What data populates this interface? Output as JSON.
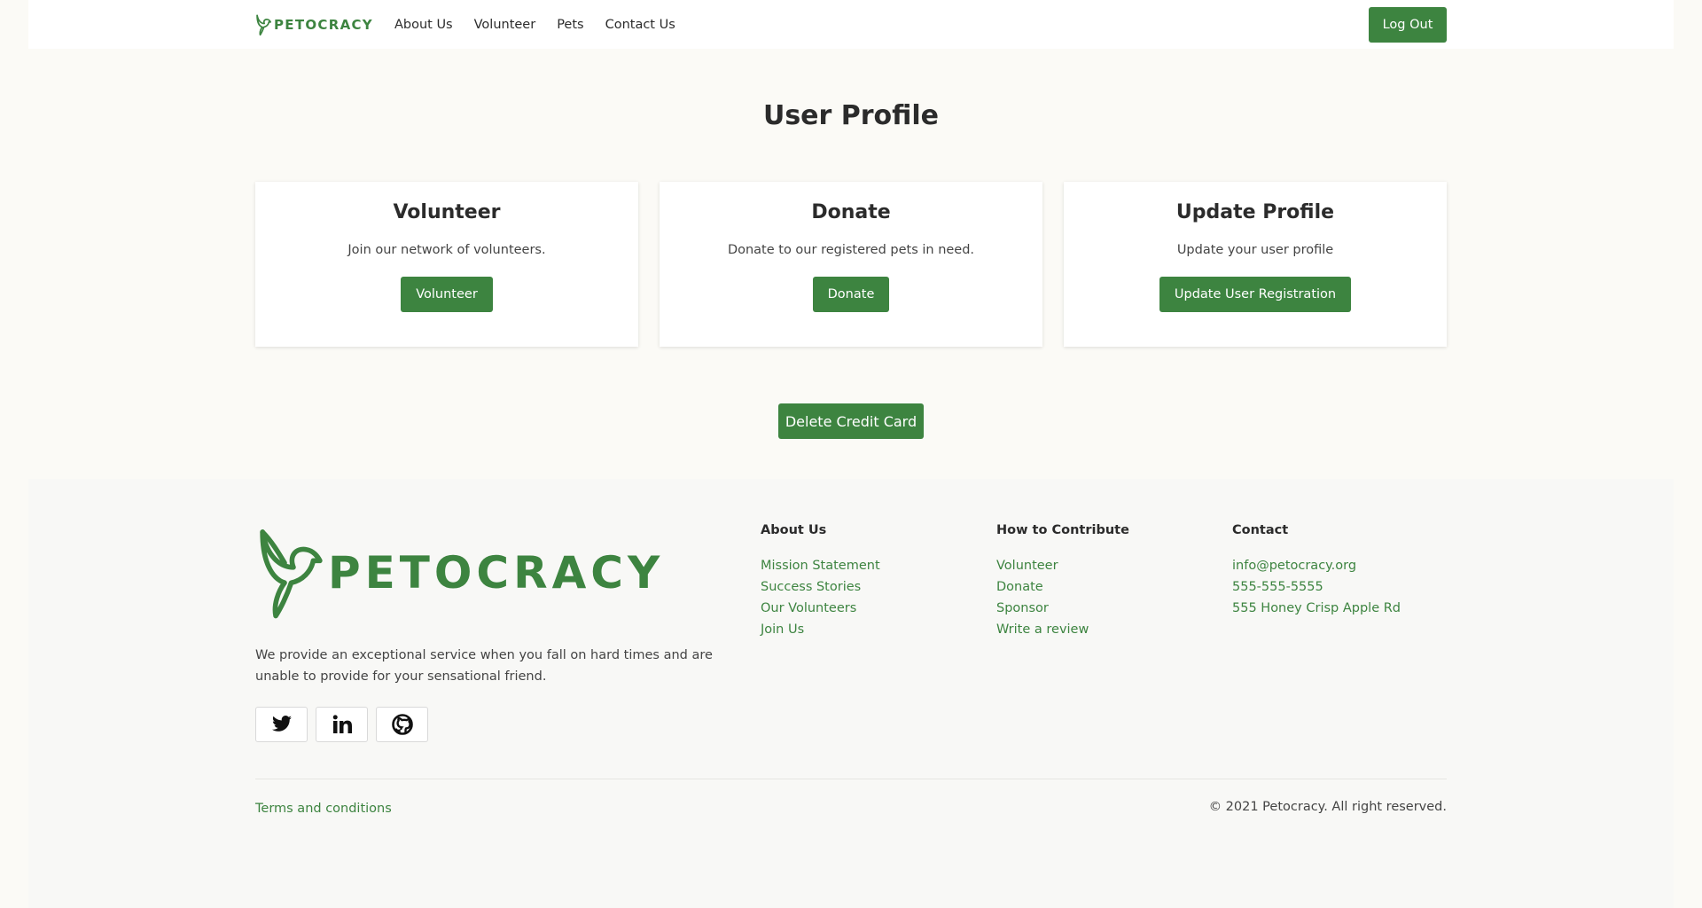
{
  "nav": {
    "logo_text": "PETOCRACY",
    "links": [
      "About Us",
      "Volunteer",
      "Pets",
      "Contact Us"
    ],
    "logout_label": "Log Out"
  },
  "page": {
    "title": "User Profile"
  },
  "cards": [
    {
      "title": "Volunteer",
      "text": "Join our network of volunteers.",
      "button": "Volunteer"
    },
    {
      "title": "Donate",
      "text": "Donate to our registered pets in need.",
      "button": "Donate"
    },
    {
      "title": "Update Profile",
      "text": "Update your user profile",
      "button": "Update User Registration"
    }
  ],
  "delete_card_label": "Delete Credit Card",
  "footer": {
    "logo_text": "PETOCRACY",
    "description": "We provide an exceptional service when you fall on hard times and are unable to provide for your sensational friend.",
    "social": [
      "twitter-icon",
      "linkedin-icon",
      "github-icon"
    ],
    "columns": [
      {
        "heading": "About Us",
        "links": [
          "Mission Statement",
          "Success Stories",
          "Our Volunteers",
          "Join Us"
        ]
      },
      {
        "heading": "How to Contribute",
        "links": [
          "Volunteer",
          "Donate",
          "Sponsor",
          "Write a review"
        ]
      },
      {
        "heading": "Contact",
        "links": [
          "info@petocracy.org",
          "555-555-5555",
          "555 Honey Crisp Apple Rd"
        ]
      }
    ],
    "terms": "Terms and conditions",
    "copyright": "© 2021 Petocracy. All right reserved."
  },
  "colors": {
    "brand": "#3d8440",
    "background": "#fbfaf6",
    "footer": "#f8f8f6"
  }
}
